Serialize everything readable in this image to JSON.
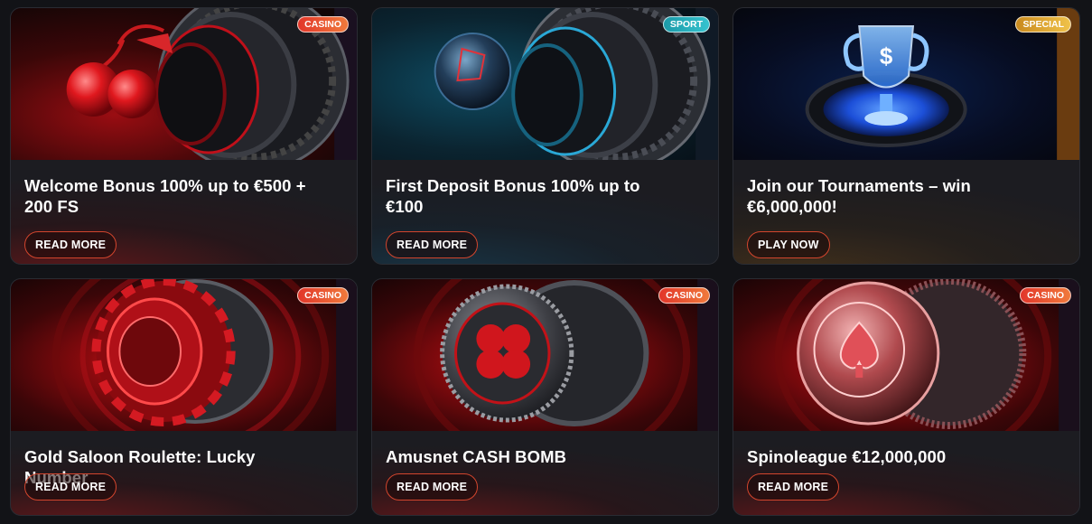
{
  "promotions": [
    {
      "title": "Welcome Bonus 100% up to €500 + 200 FS",
      "badge": "CASINO",
      "button": "READ MORE",
      "art": "cherries-roulette"
    },
    {
      "title": "First Deposit Bonus 100% up to €100",
      "badge": "SPORT",
      "button": "READ MORE",
      "art": "football-roulette"
    },
    {
      "title": "Join our Tournaments – win €6,000,000!",
      "badge": "SPECIAL",
      "button": "PLAY NOW",
      "art": "trophy"
    },
    {
      "title": "Gold Saloon Roulette: Lucky Number",
      "badge": "CASINO",
      "button": "READ MORE",
      "art": "poker-chip"
    },
    {
      "title": "Amusnet CASH BOMB",
      "badge": "CASINO",
      "button": "READ MORE",
      "art": "clover-coin"
    },
    {
      "title": "Spinoleague €12,000,000",
      "badge": "CASINO",
      "button": "READ MORE",
      "art": "spade-coin"
    }
  ],
  "colors": {
    "background": "#121317",
    "button_border": "#d2452d",
    "casino_badge": "#e2362a",
    "sport_badge": "#1c9aa8",
    "special_badge": "#c98a1e"
  }
}
